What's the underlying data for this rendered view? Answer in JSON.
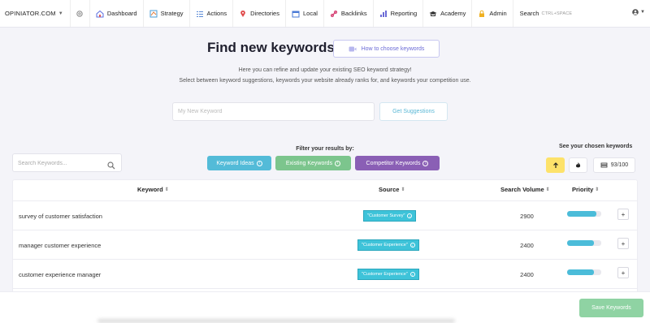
{
  "nav": {
    "brand": "OPINIATOR.COM",
    "items": [
      {
        "label": "Dashboard",
        "icon": "home-icon"
      },
      {
        "label": "Strategy",
        "icon": "strategy-icon"
      },
      {
        "label": "Actions",
        "icon": "list-icon"
      },
      {
        "label": "Directories",
        "icon": "pin-icon"
      },
      {
        "label": "Local",
        "icon": "calendar-icon"
      },
      {
        "label": "Backlinks",
        "icon": "link-icon"
      },
      {
        "label": "Reporting",
        "icon": "chart-icon"
      },
      {
        "label": "Academy",
        "icon": "graduation-icon"
      },
      {
        "label": "Admin",
        "icon": "lock-icon"
      }
    ],
    "search_label": "Search",
    "search_hint": "CTRL+SPACE"
  },
  "header": {
    "title": "Find new keywords",
    "howto_label": "How to choose keywords",
    "desc1": "Here you can refine and update your existing SEO keyword strategy!",
    "desc2": "Select between keyword suggestions, keywords your website already ranks for, and keywords your competition use.",
    "keyword_placeholder": "My New Keyword",
    "suggest_label": "Get Suggestions"
  },
  "filters": {
    "search_placeholder": "Search Keywords...",
    "label": "Filter your results by:",
    "chips": [
      "Keyword Ideas",
      "Existing Keywords",
      "Competitor Keywords"
    ],
    "chosen_label": "See your chosen keywords",
    "count": "93/100"
  },
  "table": {
    "headers": {
      "keyword": "Keyword",
      "source": "Source",
      "volume": "Search Volume",
      "priority": "Priority"
    },
    "rows": [
      {
        "keyword": "survey of customer satisfaction",
        "source": "\"Customer Survey\"",
        "volume": "2900",
        "priority": 0.85
      },
      {
        "keyword": "manager customer experience",
        "source": "\"Customer Experience\"",
        "volume": "2400",
        "priority": 0.78
      },
      {
        "keyword": "customer experience manager",
        "source": "\"Customer Experience\"",
        "volume": "2400",
        "priority": 0.78
      }
    ],
    "add_label": "+"
  },
  "footer": {
    "save_label": "Save Keywords"
  },
  "colors": {
    "accent": "#53bbd8",
    "green": "#7cc58d",
    "purple": "#8a5fb5",
    "yellow": "#fde26a"
  }
}
